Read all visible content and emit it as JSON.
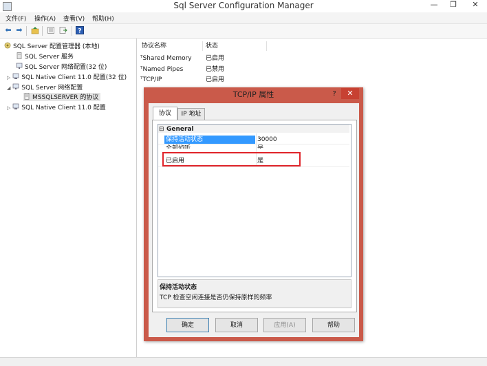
{
  "window": {
    "title": "Sql Server Configuration Manager",
    "minimize": "—",
    "restore": "❐",
    "close": "✕"
  },
  "menu": [
    "文件(F)",
    "操作(A)",
    "查看(V)",
    "帮助(H)"
  ],
  "toolbar": {
    "icons": [
      "back-arrow-icon",
      "forward-arrow-icon",
      "up-folder-icon",
      "properties-icon",
      "export-list-icon",
      "help-icon"
    ]
  },
  "tree": {
    "root": "SQL Server 配置管理器 (本地)",
    "items": [
      "SQL Server 服务",
      "SQL Server 网络配置(32 位)",
      "SQL Native Client 11.0 配置(32 位)",
      "SQL Server 网络配置",
      "MSSQLSERVER 的协议",
      "SQL Native Client 11.0 配置"
    ]
  },
  "list": {
    "columns": [
      "协议名称",
      "状态"
    ],
    "rows": [
      {
        "name": "Shared Memory",
        "status": "已启用"
      },
      {
        "name": "Named Pipes",
        "status": "已禁用"
      },
      {
        "name": "TCP/IP",
        "status": "已启用"
      }
    ]
  },
  "dialog": {
    "title": "TCP/IP 属性",
    "help": "?",
    "close": "✕",
    "tabs": [
      "协议",
      "IP 地址"
    ],
    "section": "General",
    "section_toggle": "⊟",
    "properties": [
      {
        "name": "保持活动状态",
        "value": "30000"
      },
      {
        "name": "全部侦听",
        "value": "是"
      },
      {
        "name": "已启用",
        "value": "是"
      }
    ],
    "description_title": "保持活动状态",
    "description_text": "TCP 检查空闲连接是否仍保持原样的频率",
    "buttons": {
      "ok": "确定",
      "cancel": "取消",
      "apply": "应用(A)",
      "help": "帮助"
    }
  },
  "colors": {
    "dialog_frame": "#ca5a4a",
    "close_button": "#c74132",
    "selection": "#3399ff",
    "highlight_box": "#e0242a"
  }
}
